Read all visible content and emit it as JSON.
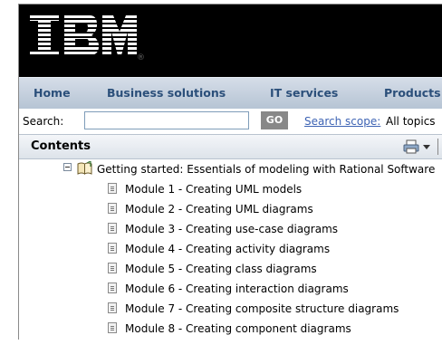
{
  "header": {
    "logo_text": "IBM"
  },
  "nav": {
    "items": [
      "Home",
      "Business solutions",
      "IT services",
      "Products"
    ]
  },
  "search": {
    "label": "Search:",
    "input_value": "",
    "go_label": "GO",
    "scope_link": "Search scope:",
    "scope_value": "All topics"
  },
  "contents": {
    "title": "Contents",
    "icons": [
      "print-icon",
      "dropdown-caret-icon"
    ]
  },
  "tree": {
    "root": {
      "label": "Getting started: Essentials of modeling with Rational Software",
      "icon": "open-book-icon",
      "expander": "collapse-icon"
    },
    "modules": [
      "Module 1 - Creating UML models",
      "Module 2 - Creating UML diagrams",
      "Module 3 - Creating use-case diagrams",
      "Module 4 - Creating activity diagrams",
      "Module 5 - Creating class diagrams",
      "Module 6 - Creating interaction diagrams",
      "Module 7 - Creating composite structure diagrams",
      "Module 8 - Creating component diagrams"
    ]
  }
}
